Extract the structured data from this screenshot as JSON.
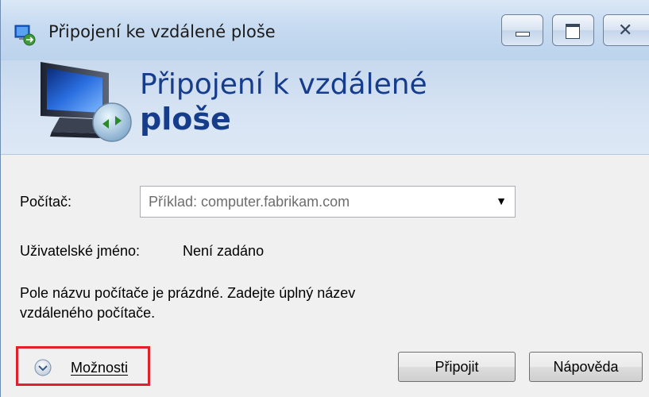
{
  "window": {
    "title": "Připojení ke vzdálené ploše",
    "icon": "remote-desktop-icon"
  },
  "header": {
    "title_line1": "Připojení k vzdálené",
    "title_line2": "ploše",
    "icon": "remote-desktop-monitor-icon"
  },
  "form": {
    "computer_label": "Počítač:",
    "computer_value": "Příklad: computer.fabrikam.com",
    "username_label": "Uživatelské jméno:",
    "username_value": "Není zadáno",
    "message_line1": "Pole názvu počítače je prázdné. Zadejte úplný název",
    "message_line2": "vzdáleného počítače."
  },
  "footer": {
    "options_label": "Možnosti",
    "options_icon": "chevron-down-circle-icon",
    "connect_label": "Připojit",
    "help_label": "Nápověda"
  },
  "colors": {
    "header_title": "#163c8c",
    "highlight": "#e0202a"
  }
}
